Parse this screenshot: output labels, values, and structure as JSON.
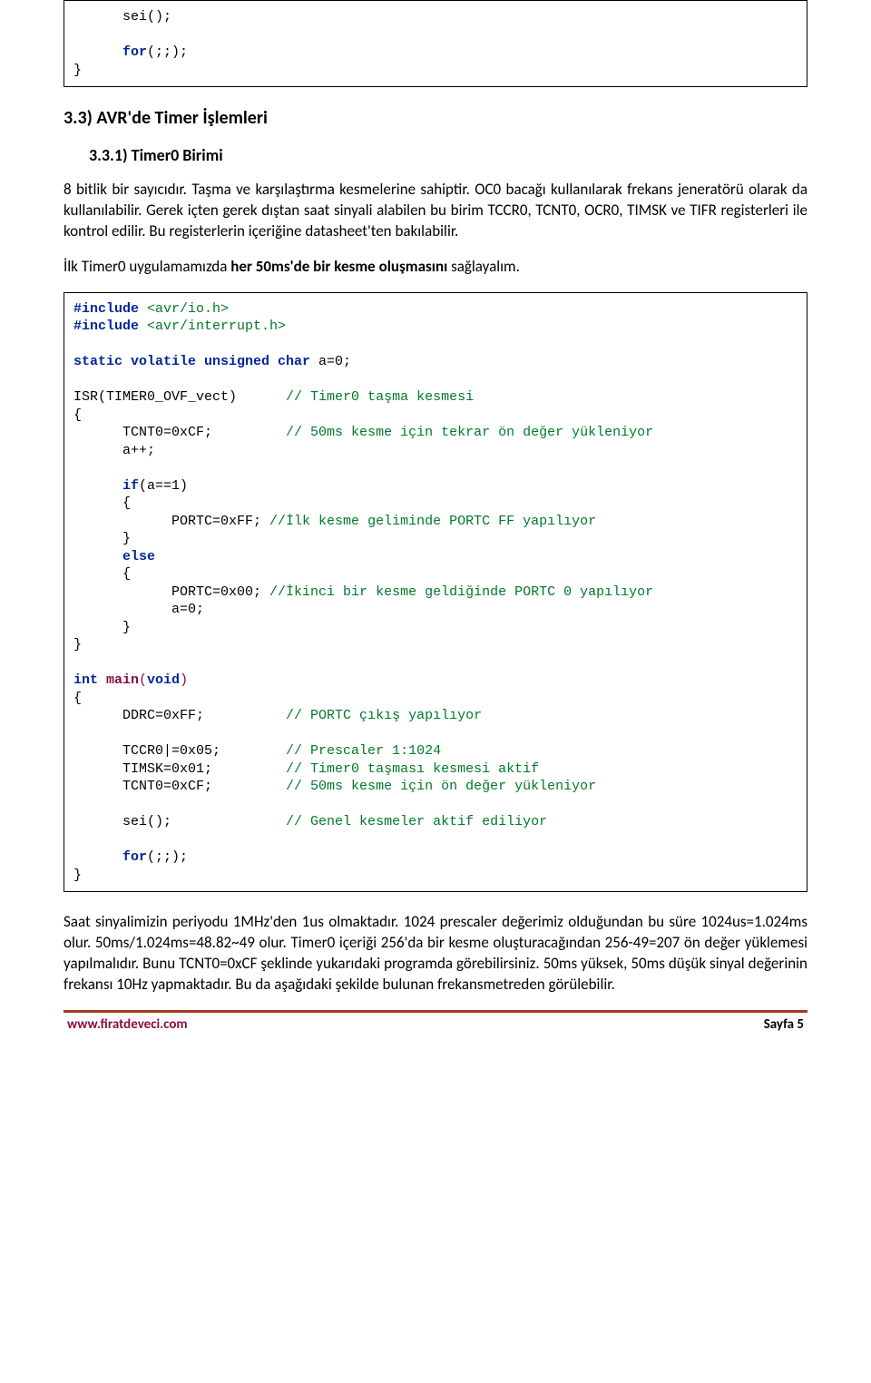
{
  "code1": {
    "l1": "      sei();",
    "l2": "",
    "l3_a": "      ",
    "l3_for": "for",
    "l3_b": "(;;);",
    "l4": "}"
  },
  "h2": "3.3) AVR'de Timer İşlemleri",
  "h3": "3.3.1) Timer0 Birimi",
  "p1": "8 bitlik bir sayıcıdır. Taşma ve karşılaştırma kesmelerine sahiptir. OC0 bacağı kullanılarak frekans jeneratörü olarak da kullanılabilir. Gerek içten gerek dıştan saat sinyali alabilen bu birim TCCR0, TCNT0, OCR0, TIMSK ve TIFR registerleri ile kontrol edilir. Bu registerlerin içeriğine datasheet'ten bakılabilir.",
  "p2_a": "İlk Timer0 uygulamamızda ",
  "p2_b": "her 50ms'de bir kesme oluşmasını",
  "p2_c": " sağlayalım.",
  "code2": {
    "inc1_a": "#include",
    "inc1_b": " <avr/io.h>",
    "inc2_a": "#include",
    "inc2_b": " <avr/interrupt.h>",
    "blank": "",
    "sv": "static volatile unsigned char ",
    "sv_b": "a=0;",
    "isr_a": "ISR(TIMER0_OVF_vect)      ",
    "isr_c": "// Timer0 taşma kesmesi",
    "lb": "{",
    "tcnt_a": "      TCNT0=0xCF;         ",
    "tcnt_c": "// 50ms kesme için tekrar ön değer yükleniyor",
    "app": "      a++;",
    "if_sp": "      ",
    "if_kw": "if",
    "if_b": "(a==1)",
    "lb2": "      {",
    "pc1_a": "            PORTC=0xFF; ",
    "pc1_c": "//İlk kesme geliminde PORTC FF yapılıyor",
    "rb2": "      }",
    "else_sp": "      ",
    "else_kw": "else",
    "lb3": "      {",
    "pc2_a": "            PORTC=0x00; ",
    "pc2_c": "//İkinci bir kesme geldiğinde PORTC 0 yapılıyor",
    "a0": "            a=0;",
    "rb3": "      }",
    "rb": "}",
    "main_a": "int ",
    "main_b": "main",
    "main_c": "(",
    "main_d": "void",
    "main_e": ")",
    "mlb": "{",
    "ddrc_a": "      DDRC=0xFF;          ",
    "ddrc_c": "// PORTC çıkış yapılıyor",
    "tccr_a": "      TCCR0|=0x05;        ",
    "tccr_c": "// Prescaler 1:1024",
    "timsk_a": "      TIMSK=0x01;         ",
    "timsk_c": "// Timer0 taşması kesmesi aktif",
    "tcnt2_a": "      TCNT0=0xCF;         ",
    "tcnt2_c": "// 50ms kesme için ön değer yükleniyor",
    "sei_a": "      sei();              ",
    "sei_c": "// Genel kesmeler aktif ediliyor",
    "for_sp": "      ",
    "for_kw": "for",
    "for_b": "(;;);",
    "mrb": "}"
  },
  "p3": "Saat sinyalimizin periyodu 1MHz'den 1us olmaktadır. 1024 prescaler değerimiz olduğundan bu süre 1024us=1.024ms olur. 50ms/1.024ms=48.82~49 olur. Timer0 içeriği 256'da bir kesme oluşturacağından 256-49=207 ön değer yüklemesi yapılmalıdır. Bunu TCNT0=0xCF şeklinde yukarıdaki programda görebilirsiniz. 50ms yüksek, 50ms düşük sinyal değerinin frekansı 10Hz yapmaktadır. Bu da aşağıdaki şekilde bulunan frekansmetreden görülebilir.",
  "footer": {
    "left": "www.firatdeveci.com",
    "right": "Sayfa 5"
  }
}
